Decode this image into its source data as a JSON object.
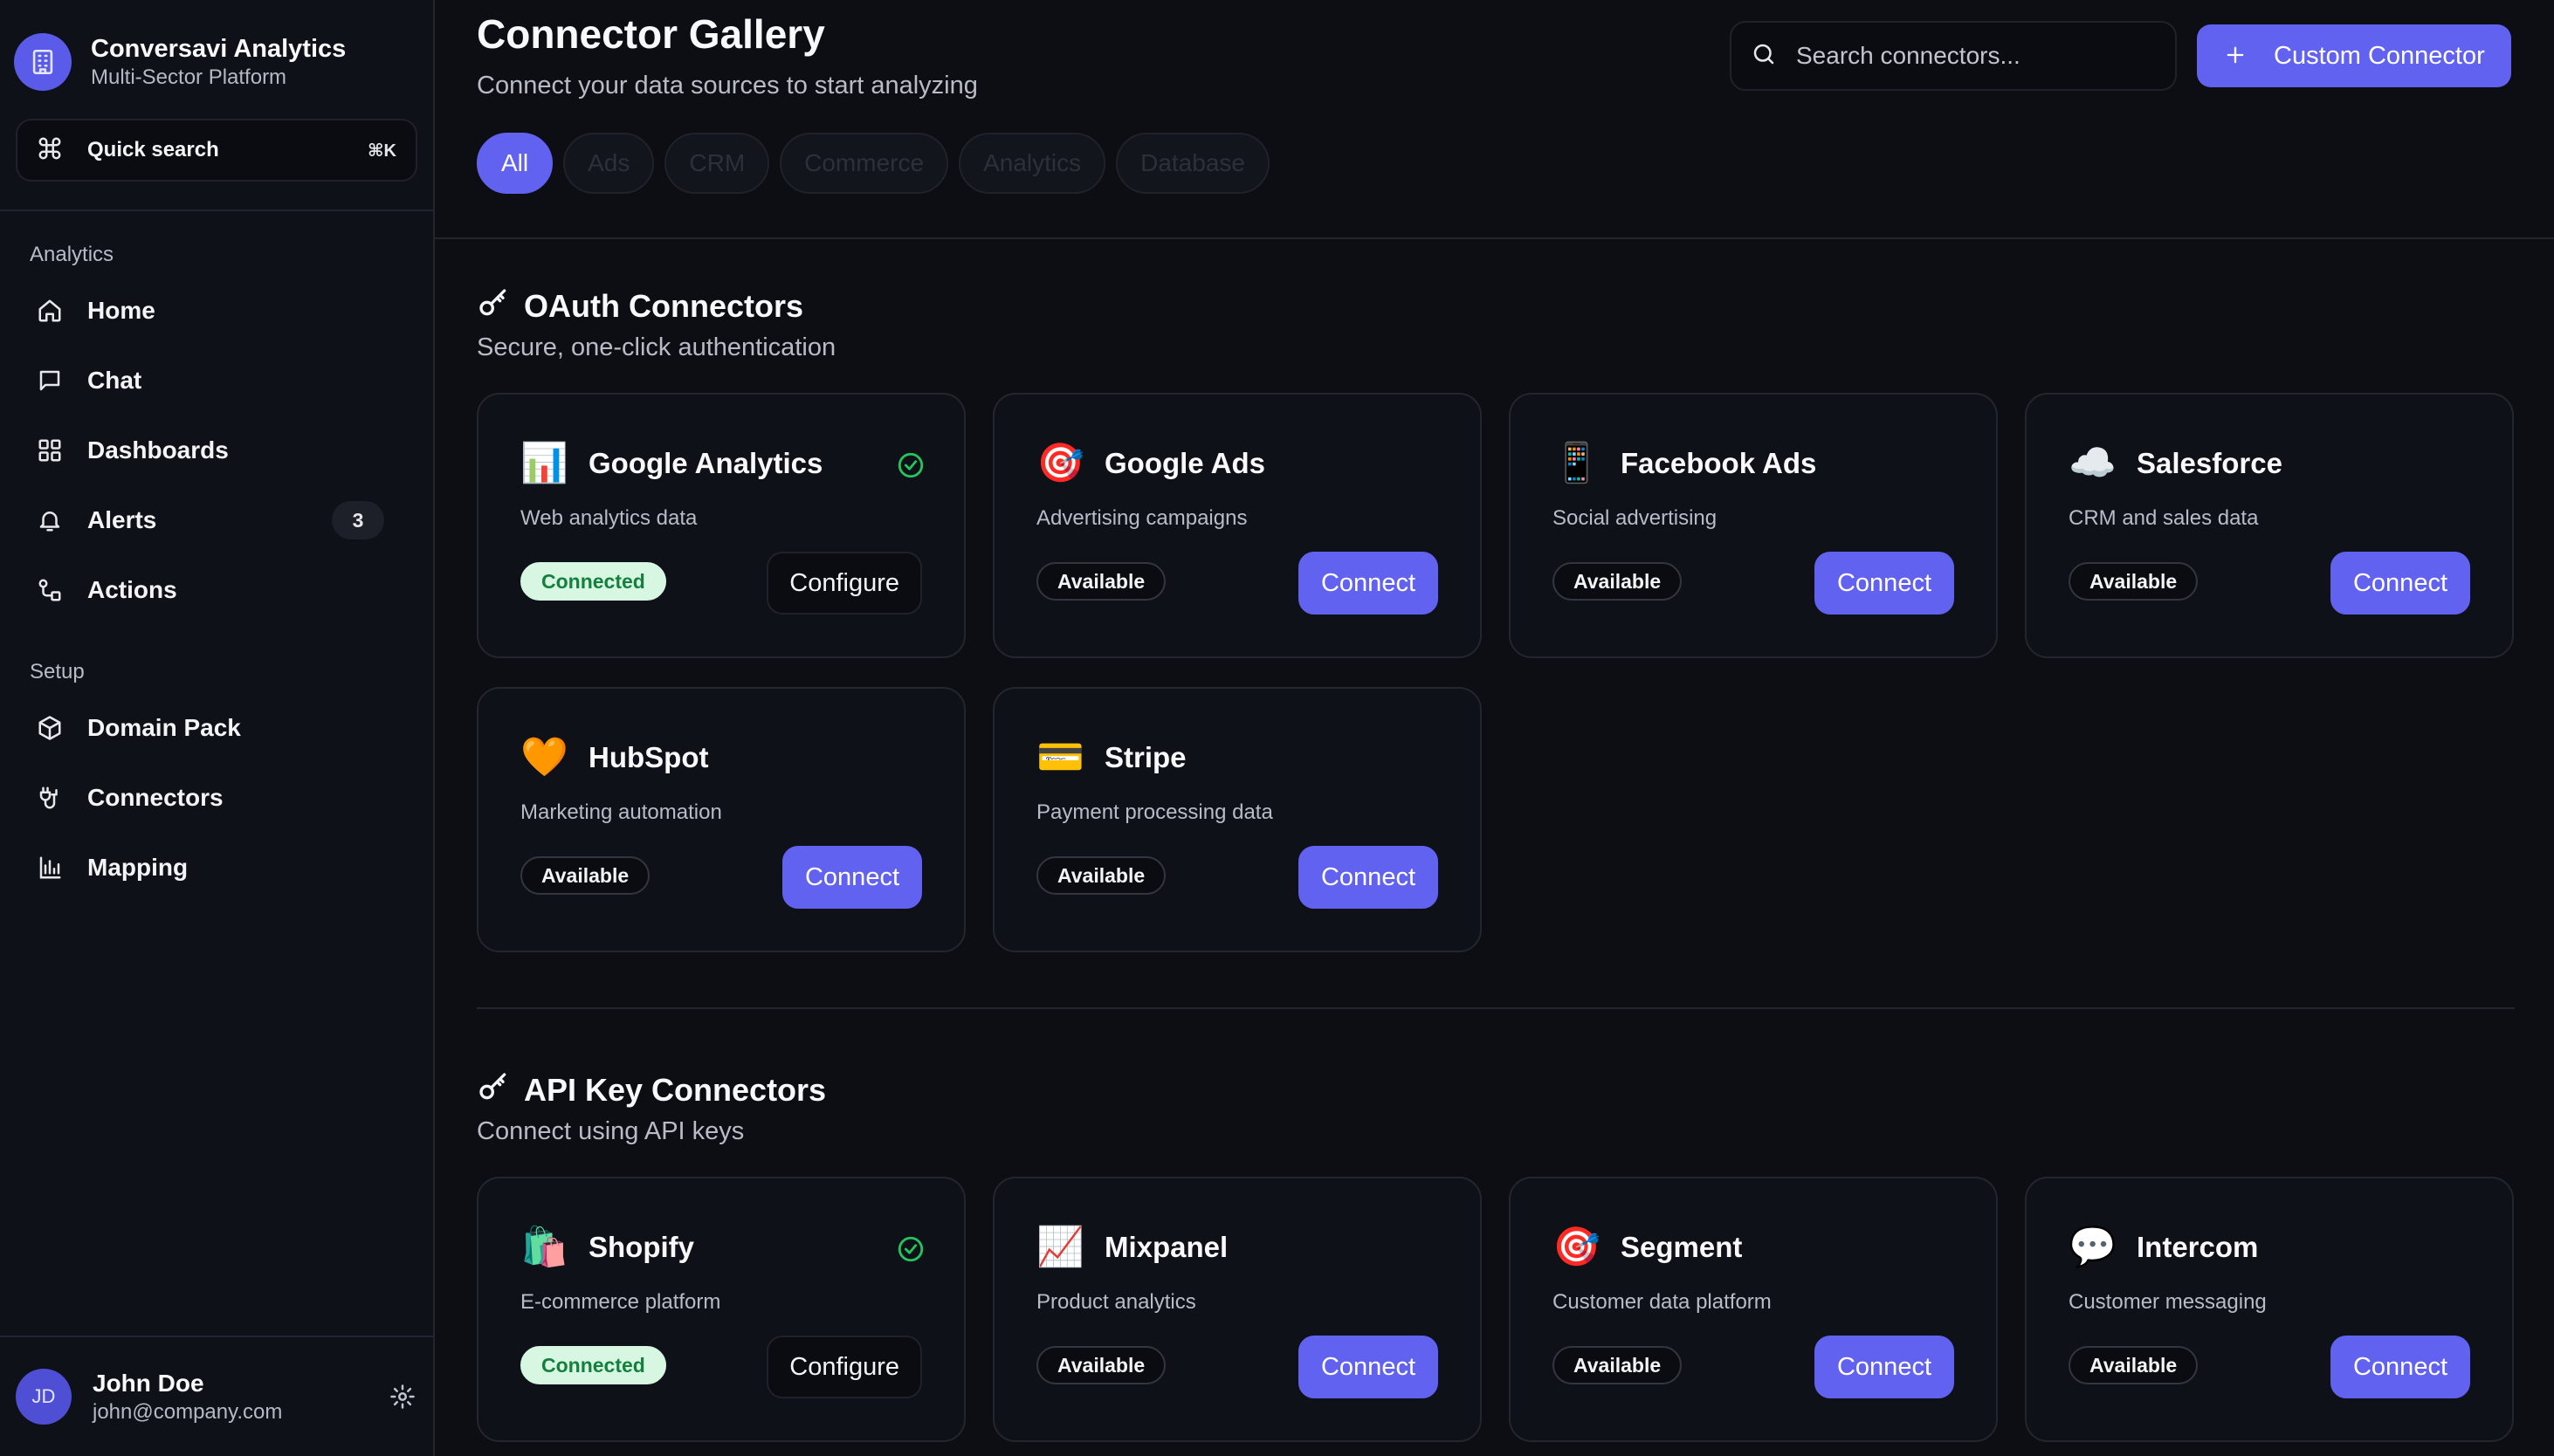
{
  "brand": {
    "name": "Conversavi Analytics",
    "subtitle": "Multi-Sector Platform"
  },
  "quick_search": {
    "label": "Quick search",
    "shortcut": "⌘K"
  },
  "sidebar": {
    "analytics_label": "Analytics",
    "analytics_items": [
      {
        "label": "Home",
        "icon": "home-icon"
      },
      {
        "label": "Chat",
        "icon": "chat-icon"
      },
      {
        "label": "Dashboards",
        "icon": "grid-icon"
      },
      {
        "label": "Alerts",
        "icon": "bell-icon",
        "badge": "3"
      },
      {
        "label": "Actions",
        "icon": "actions-icon"
      }
    ],
    "setup_label": "Setup",
    "setup_items": [
      {
        "label": "Domain Pack",
        "icon": "package-icon"
      },
      {
        "label": "Connectors",
        "icon": "plug-icon"
      },
      {
        "label": "Mapping",
        "icon": "bar-chart-icon"
      }
    ]
  },
  "user": {
    "initials": "JD",
    "name": "John Doe",
    "email": "john@company.com"
  },
  "header": {
    "title": "Connector Gallery",
    "subtitle": "Connect your data sources to start analyzing",
    "search_placeholder": "Search connectors...",
    "custom_button": "Custom Connector"
  },
  "filters": [
    "All",
    "Ads",
    "CRM",
    "Commerce",
    "Analytics",
    "Database"
  ],
  "oauth": {
    "title": "OAuth Connectors",
    "description": "Secure, one-click authentication",
    "connectors": [
      {
        "name": "Google Analytics",
        "emoji": "📊",
        "description": "Web analytics data",
        "status": "Connected",
        "action": "Configure"
      },
      {
        "name": "Google Ads",
        "emoji": "🎯",
        "description": "Advertising campaigns",
        "status": "Available",
        "action": "Connect"
      },
      {
        "name": "Facebook Ads",
        "emoji": "📱",
        "description": "Social advertising",
        "status": "Available",
        "action": "Connect"
      },
      {
        "name": "Salesforce",
        "emoji": "☁️",
        "description": "CRM and sales data",
        "status": "Available",
        "action": "Connect"
      },
      {
        "name": "HubSpot",
        "emoji": "🧡",
        "description": "Marketing automation",
        "status": "Available",
        "action": "Connect"
      },
      {
        "name": "Stripe",
        "emoji": "💳",
        "description": "Payment processing data",
        "status": "Available",
        "action": "Connect"
      }
    ]
  },
  "apikey": {
    "title": "API Key Connectors",
    "description": "Connect using API keys",
    "connectors": [
      {
        "name": "Shopify",
        "emoji": "🛍️",
        "description": "E-commerce platform",
        "status": "Connected",
        "action": "Configure"
      },
      {
        "name": "Mixpanel",
        "emoji": "📈",
        "description": "Product analytics",
        "status": "Available",
        "action": "Connect"
      },
      {
        "name": "Segment",
        "emoji": "🎯",
        "description": "Customer data platform",
        "status": "Available",
        "action": "Connect"
      },
      {
        "name": "Intercom",
        "emoji": "💬",
        "description": "Customer messaging",
        "status": "Available",
        "action": "Connect"
      }
    ]
  },
  "colors": {
    "accent": "#6262f1",
    "background": "#0d0e13",
    "connected_bg": "#d8f7e3",
    "connected_text": "#15803d",
    "check": "#22c55e"
  }
}
